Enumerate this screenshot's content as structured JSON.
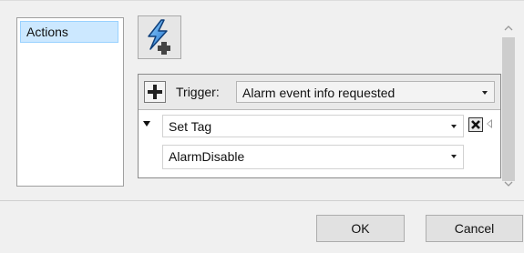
{
  "sidebar": {
    "items": [
      {
        "label": "Actions",
        "selected": true
      }
    ]
  },
  "toolbar": {
    "add_action_icon": "lightning-plus-icon"
  },
  "action": {
    "add_trigger_icon": "plus-icon",
    "trigger_label": "Trigger:",
    "trigger_value": "Alarm event info requested",
    "action_type_value": "Set Tag",
    "tag_value": "AlarmDisable",
    "remove_icon": "close-icon"
  },
  "buttons": {
    "ok_label": "OK",
    "cancel_label": "Cancel"
  },
  "colors": {
    "selected_bg": "#cce8ff",
    "selected_border": "#99d1ff",
    "lightning_blue": "#1f7fd6"
  }
}
